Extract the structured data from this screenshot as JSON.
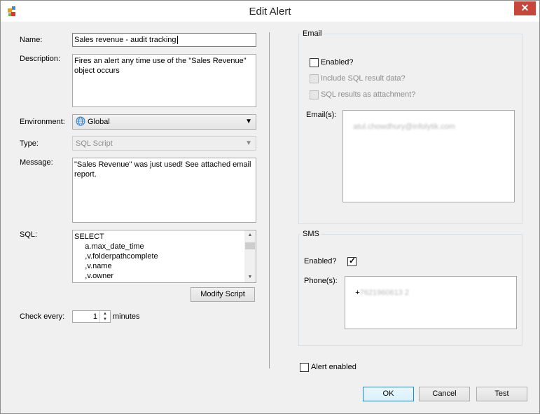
{
  "window": {
    "title": "Edit Alert",
    "close_glyph": "✕"
  },
  "form": {
    "name_label": "Name:",
    "name_value": "Sales revenue - audit tracking",
    "description_label": "Description:",
    "description_value": "Fires an alert any time use of the \"Sales Revenue\" object occurs",
    "environment_label": "Environment:",
    "environment_value": "Global",
    "environment_icon": "globe-icon",
    "type_label": "Type:",
    "type_value": "SQL Script",
    "message_label": "Message:",
    "message_value": "\"Sales Revenue\" was just used! See attached email report.",
    "sql_label": "SQL:",
    "sql_lines": [
      "SELECT",
      "     a.max_date_time",
      "     ,v.folderpathcomplete",
      "     ,v.name",
      "     ,v.owner"
    ],
    "modify_script_label": "Modify Script",
    "check_every_label": "Check every:",
    "check_every_value": "1",
    "minutes_label": "minutes"
  },
  "email": {
    "group_title": "Email",
    "enabled_label": "Enabled?",
    "enabled_checked": false,
    "include_sql_label": "Include SQL result data?",
    "attachment_label": "SQL results as attachment?",
    "emails_label": "Email(s):",
    "emails_value": "atul.chowdhury@infolytik.com"
  },
  "sms": {
    "group_title": "SMS",
    "enabled_label": "Enabled?",
    "enabled_checked": true,
    "check_glyph": "✓",
    "phones_label": "Phone(s):",
    "phone_prefix": "+",
    "phone_value": "7621960613 2"
  },
  "footer": {
    "alert_enabled_label": "Alert enabled",
    "alert_enabled_checked": false,
    "ok_label": "OK",
    "cancel_label": "Cancel",
    "test_label": "Test"
  },
  "colors": {
    "close_button": "#c7463b",
    "accent_border": "#3c7fb1",
    "dialog_bg": "#f0f0f0"
  }
}
